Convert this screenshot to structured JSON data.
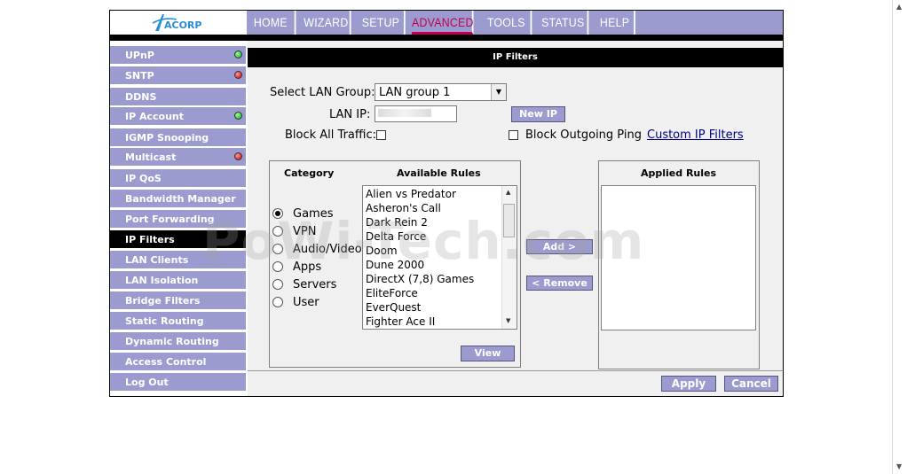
{
  "logo": {
    "text": "ACORP"
  },
  "nav": [
    {
      "label": "HOME"
    },
    {
      "label": "WIZARD"
    },
    {
      "label": "SETUP"
    },
    {
      "label": "ADVANCED",
      "active": true
    },
    {
      "label": "TOOLS"
    },
    {
      "label": "STATUS"
    },
    {
      "label": "HELP"
    }
  ],
  "sidebar": {
    "items": [
      {
        "label": "UPnP",
        "status": "green"
      },
      {
        "label": "SNTP",
        "status": "red"
      },
      {
        "label": "DDNS"
      },
      {
        "label": "IP Account",
        "status": "green"
      },
      {
        "label": "IGMP Snooping"
      },
      {
        "label": "Multicast",
        "status": "red"
      },
      {
        "label": "IP QoS"
      },
      {
        "label": "Bandwidth Manager"
      },
      {
        "label": "Port Forwarding"
      },
      {
        "label": "IP Filters",
        "active": true
      },
      {
        "label": "LAN Clients"
      },
      {
        "label": "LAN Isolation"
      },
      {
        "label": "Bridge Filters"
      },
      {
        "label": "Static Routing"
      },
      {
        "label": "Dynamic Routing"
      },
      {
        "label": "Access Control"
      },
      {
        "label": "Log Out"
      }
    ]
  },
  "page": {
    "title": "IP Filters",
    "select_lan_group_label": "Select LAN Group:",
    "lan_group_value": "LAN group 1",
    "lan_ip_label": "LAN IP:",
    "new_ip_button": "New IP",
    "block_all_traffic_label": "Block All Traffic:",
    "block_outgoing_ping_label": "Block Outgoing Ping",
    "custom_ip_filters_link": "Custom IP Filters",
    "category_header": "Category",
    "available_rules_header": "Available Rules",
    "applied_rules_header": "Applied Rules",
    "categories": [
      {
        "label": "Games",
        "selected": true
      },
      {
        "label": "VPN"
      },
      {
        "label": "Audio/Video"
      },
      {
        "label": "Apps"
      },
      {
        "label": "Servers"
      },
      {
        "label": "User"
      }
    ],
    "available_rules": [
      "Alien vs Predator",
      "Asheron's Call",
      "Dark Rein 2",
      "Delta Force",
      "Doom",
      "Dune 2000",
      "DirectX (7,8) Games",
      "EliteForce",
      "EverQuest",
      "Fighter Ace II"
    ],
    "add_button": "Add >",
    "remove_button": "< Remove",
    "view_button": "View",
    "apply_button": "Apply",
    "cancel_button": "Cancel"
  },
  "watermark": "PoWi-Tech.com",
  "colors": {
    "nav_bg": "#9b9bcf",
    "active_nav": "#c0004f",
    "sidebar_bg": "#9b9bcf",
    "content_bg": "#f0f0f0",
    "link": "#000080"
  }
}
